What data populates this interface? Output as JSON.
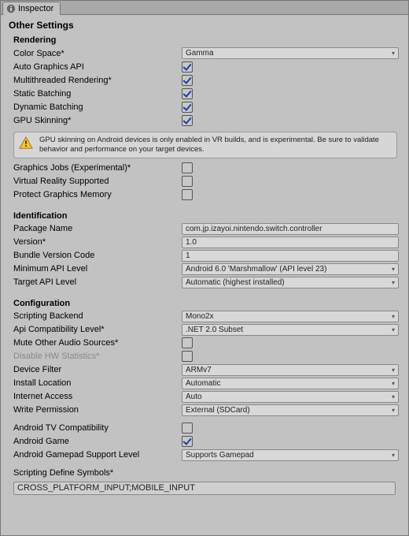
{
  "tab": {
    "title": "Inspector",
    "icon": "info-icon"
  },
  "header": {
    "title": "Other Settings"
  },
  "rendering": {
    "title": "Rendering",
    "color_space_label": "Color Space*",
    "color_space_value": "Gamma",
    "auto_graphics_api_label": "Auto Graphics API",
    "auto_graphics_api_checked": true,
    "multithreaded_label": "Multithreaded Rendering*",
    "multithreaded_checked": true,
    "static_batching_label": "Static Batching",
    "static_batching_checked": true,
    "dynamic_batching_label": "Dynamic Batching",
    "dynamic_batching_checked": true,
    "gpu_skinning_label": "GPU Skinning*",
    "gpu_skinning_checked": true,
    "warning_text": "GPU skinning on Android devices is only enabled in VR builds, and is experimental. Be sure to validate behavior and performance on your target devices.",
    "graphics_jobs_label": "Graphics Jobs (Experimental)*",
    "graphics_jobs_checked": false,
    "vr_supported_label": "Virtual Reality Supported",
    "vr_supported_checked": false,
    "protect_gm_label": "Protect Graphics Memory",
    "protect_gm_checked": false
  },
  "identification": {
    "title": "Identification",
    "package_name_label": "Package Name",
    "package_name_value": "com.jp.izayoi.nintendo.switch.controller",
    "version_label": "Version*",
    "version_value": "1.0",
    "bundle_code_label": "Bundle Version Code",
    "bundle_code_value": "1",
    "min_api_label": "Minimum API Level",
    "min_api_value": "Android 6.0 'Marshmallow' (API level 23)",
    "target_api_label": "Target API Level",
    "target_api_value": "Automatic (highest installed)"
  },
  "configuration": {
    "title": "Configuration",
    "scripting_backend_label": "Scripting Backend",
    "scripting_backend_value": "Mono2x",
    "api_compat_label": "Api Compatibility Level*",
    "api_compat_value": ".NET 2.0 Subset",
    "mute_audio_label": "Mute Other Audio Sources*",
    "mute_audio_checked": false,
    "disable_hw_label": "Disable HW Statistics*",
    "disable_hw_checked": false,
    "disable_hw_disabled": true,
    "device_filter_label": "Device Filter",
    "device_filter_value": "ARMv7",
    "install_location_label": "Install Location",
    "install_location_value": "Automatic",
    "internet_access_label": "Internet Access",
    "internet_access_value": "Auto",
    "write_permission_label": "Write Permission",
    "write_permission_value": "External (SDCard)",
    "tv_compat_label": "Android TV Compatibility",
    "tv_compat_checked": false,
    "android_game_label": "Android Game",
    "android_game_checked": true,
    "gamepad_support_label": "Android Gamepad Support Level",
    "gamepad_support_value": "Supports Gamepad",
    "define_symbols_label": "Scripting Define Symbols*",
    "define_symbols_value": "CROSS_PLATFORM_INPUT;MOBILE_INPUT"
  }
}
